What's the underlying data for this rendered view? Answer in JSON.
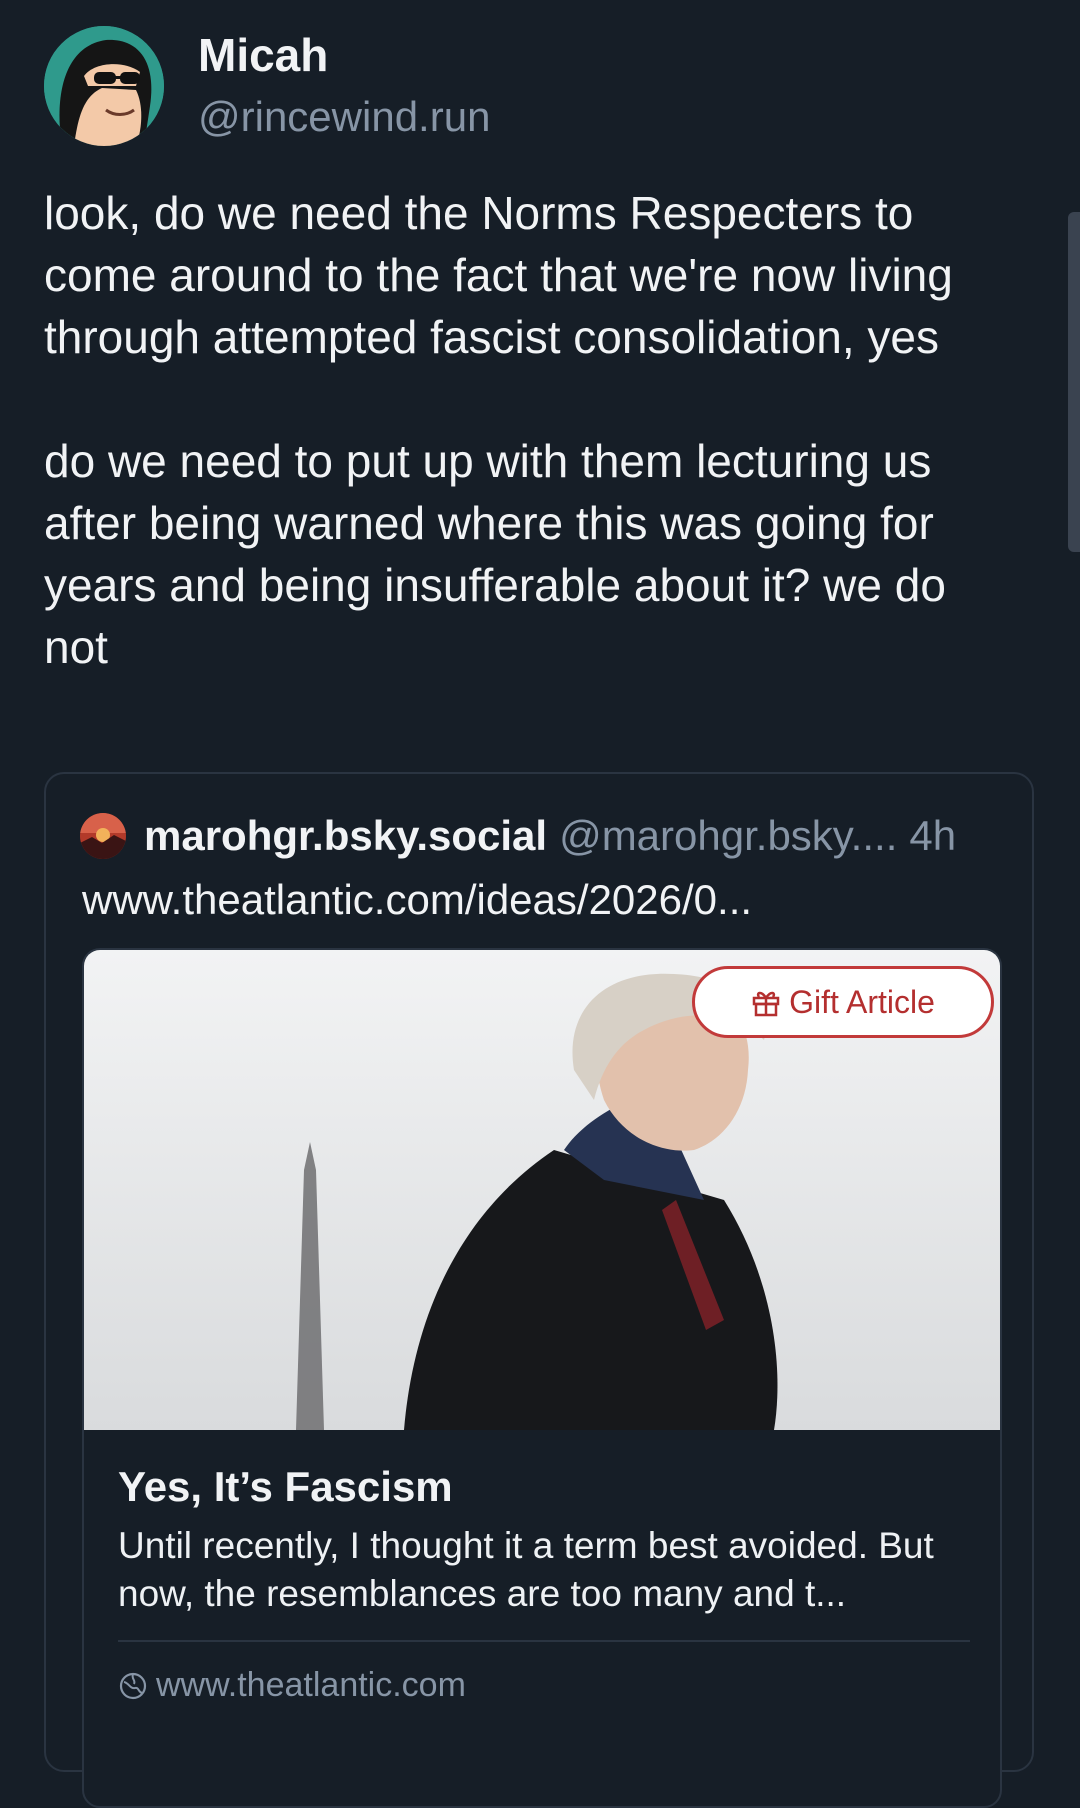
{
  "post": {
    "author": {
      "display_name": "Micah",
      "handle": "@rincewind.run",
      "avatar_icon": "cartoon-avatar"
    },
    "paragraphs": [
      "look, do we need the Norms Respecters to come around to the fact that we're now living through attempted fascist consolidation, yes",
      "do we need to put up with them lecturing us after being warned where this was going for years and being insufferable about it? we do not"
    ]
  },
  "quote": {
    "author_name": "marohgr.bsky.social",
    "author_handle": "@marohgr.bsky....",
    "time": "4h",
    "link_text": "www.theatlantic.com/ideas/2026/0...",
    "card": {
      "gift_label": "Gift Article",
      "title": "Yes, It’s Fascism",
      "description": "Until recently, I thought it a term best avoided. But now, the resemblances are too many and t...",
      "domain": "www.theatlantic.com"
    }
  },
  "colors": {
    "background": "#161e27",
    "text": "#f1f3f5",
    "muted": "#8795a6",
    "border": "#2a3441",
    "gift_red": "#c23a3a"
  }
}
